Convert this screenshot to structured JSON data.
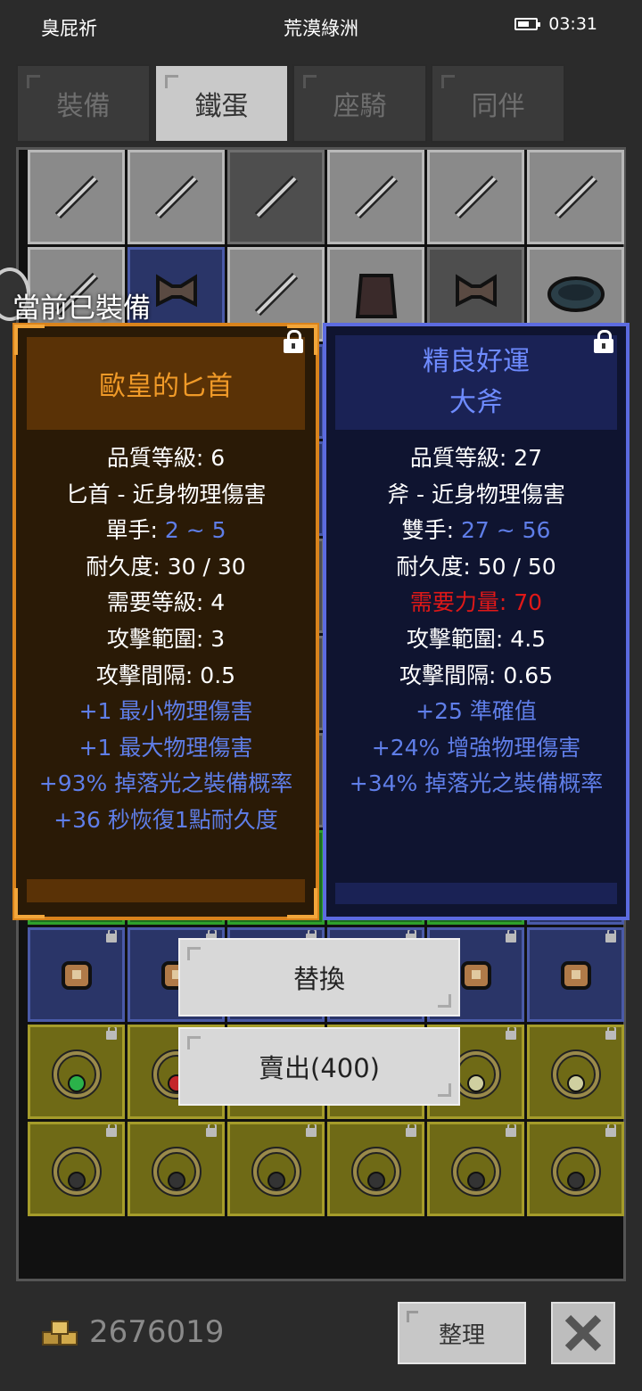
{
  "status_bar": {
    "left_text": "臭屁祈",
    "title": "荒漠綠洲",
    "time": "03:31"
  },
  "tabs": [
    {
      "label": "裝備",
      "active": false
    },
    {
      "label": "鐵蛋",
      "active": true
    },
    {
      "label": "座騎",
      "active": false
    },
    {
      "label": "同伴",
      "active": false
    }
  ],
  "equipped_label": "當前已裝備",
  "left_card": {
    "title": "歐皇的匕首",
    "quality": "品質等級: 6",
    "type": "匕首 - 近身物理傷害",
    "hand_label": "單手: ",
    "hand_value": "2 ~ 5",
    "durability": "耐久度: 30 / 30",
    "requirement": "需要等級: 4",
    "range": "攻擊範圍: 3",
    "interval": "攻擊間隔: 0.5",
    "bonuses": [
      "+1 最小物理傷害",
      "+1 最大物理傷害",
      "+93% 掉落光之裝備概率",
      "+36 秒恢復1點耐久度"
    ]
  },
  "right_card": {
    "title_line1": "精良好運",
    "title_line2": "大斧",
    "quality": "品質等級: 27",
    "type": "斧 - 近身物理傷害",
    "hand_label": "雙手: ",
    "hand_value": "27 ~ 56",
    "durability": "耐久度: 50 / 50",
    "requirement": "需要力量: 70",
    "range": "攻擊範圍: 4.5",
    "interval": "攻擊間隔: 0.65",
    "bonuses": [
      "+25 準確值",
      "+24% 增強物理傷害",
      "+34% 掉落光之裝備概率"
    ]
  },
  "actions": {
    "replace_label": "替換",
    "sell_label": "賣出(400)"
  },
  "footer": {
    "gold": "2676019",
    "sort_label": "整理"
  },
  "colors": {
    "rare_orange": "#d9831c",
    "magic_blue": "#5c6be0",
    "bonus_text": "#5f7ee8",
    "requirement_unmet": "#e01818"
  },
  "inventory_rows": [
    [
      "grey-axe",
      "grey-staff",
      "dark-sword",
      "grey-halberd",
      "grey-skull",
      "grey-gauntlet"
    ],
    [
      "grey-dagger",
      "blue-greataxe",
      "grey-trident",
      "grey-armor",
      "dark-greataxe",
      "grey-belt"
    ],
    [
      "blue",
      "blue",
      "blue",
      "blue",
      "blue",
      "blue"
    ],
    [
      "blue",
      "blue",
      "blue",
      "blue",
      "blue",
      "blue"
    ],
    [
      "orange",
      "orange",
      "orange",
      "orange",
      "orange",
      "orange"
    ],
    [
      "orange",
      "orange",
      "orange",
      "orange",
      "orange",
      "orange"
    ],
    [
      "orange",
      "orange",
      "orange",
      "orange",
      "orange",
      "orange"
    ],
    [
      "green-belt",
      "green-belt",
      "green-belt",
      "green-belt",
      "green-cape",
      "blue-scroll"
    ],
    [
      "blue-scroll",
      "blue-scroll",
      "blue-scroll",
      "blue-scroll",
      "blue-scroll",
      "blue-scroll"
    ],
    [
      "yellow-amulet-green",
      "yellow-amulet-red",
      "yellow-ring",
      "yellow-ring",
      "yellow-ring-light",
      "yellow-ring-light"
    ],
    [
      "yellow-ring",
      "yellow-ring",
      "yellow-ring",
      "yellow-ring",
      "yellow-ring",
      "yellow-ring"
    ]
  ]
}
